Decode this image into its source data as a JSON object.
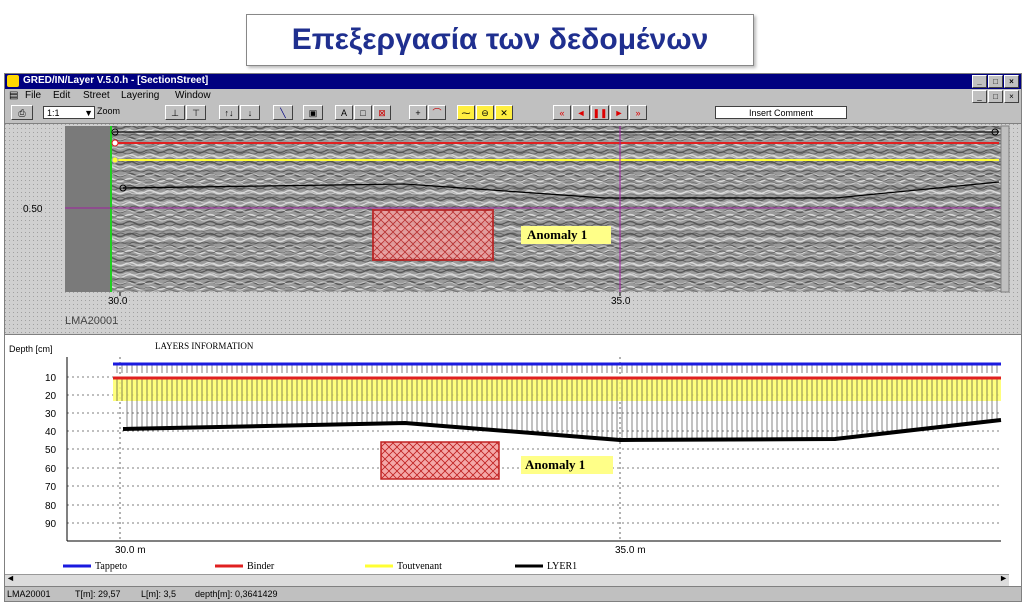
{
  "slide_title": "Επεξεργασία των δεδομένων",
  "window": {
    "title": "GRED/IN/Layer V.5.0.h - [SectionStreet]",
    "controls": [
      "_",
      "ö",
      "x"
    ]
  },
  "menu": [
    "File",
    "Edit",
    "Street",
    "Layering",
    "Window"
  ],
  "toolbar": {
    "zoom_value": "1:1",
    "zoom_label": "Zoom",
    "comment_button": "Insert Comment"
  },
  "radar": {
    "depth_tick": "0.50",
    "x_ticks": [
      "30.0",
      "35.0"
    ],
    "file_label": "LMA20001",
    "anomaly_label": "Anomaly 1"
  },
  "layers_panel": {
    "title": "LAYERS INFORMATION",
    "y_axis_label": "Depth [cm]",
    "y_ticks": [
      "10",
      "20",
      "30",
      "40",
      "50",
      "60",
      "70",
      "80",
      "90"
    ],
    "x_ticks": [
      "30.0 m",
      "35.0 m"
    ],
    "anomaly_label": "Anomaly 1",
    "legend": [
      {
        "name": "Tappeto",
        "color": "#1a1adf"
      },
      {
        "name": "Binder",
        "color": "#e02020"
      },
      {
        "name": "Toutvenant",
        "color": "#ffff33"
      },
      {
        "name": "LYER1",
        "color": "#000000"
      }
    ]
  },
  "status_bar": {
    "file": "LMA20001",
    "t": "T[m]: 29,57",
    "l": "L[m]: 3,5",
    "depth": "depth[m]: 0,3641429"
  }
}
